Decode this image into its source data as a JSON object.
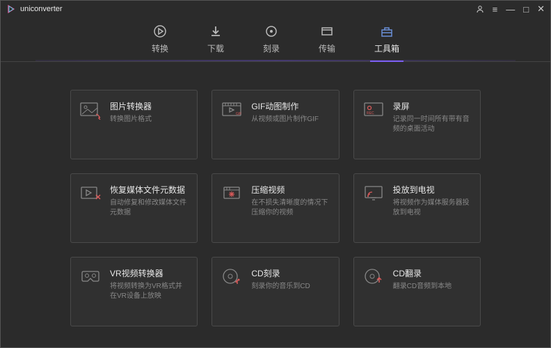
{
  "app": {
    "title": "uniconverter"
  },
  "window_controls": {
    "user": "",
    "menu": "≡",
    "minimize": "—",
    "maximize": "□",
    "close": "✕"
  },
  "tabs": [
    {
      "label": "转换"
    },
    {
      "label": "下载"
    },
    {
      "label": "刻录"
    },
    {
      "label": "传输"
    },
    {
      "label": "工具箱"
    }
  ],
  "tools": [
    {
      "title": "图片转换器",
      "desc": "转换图片格式"
    },
    {
      "title": "GIF动图制作",
      "desc": "从视频或图片制作GIF"
    },
    {
      "title": "录屏",
      "desc": "记录同一时间所有带有音频的桌面活动"
    },
    {
      "title": "恢复媒体文件元数据",
      "desc": "自动修复和修改媒体文件元数据"
    },
    {
      "title": "压缩视频",
      "desc": "在不损失清晰度的情况下压缩你的视频"
    },
    {
      "title": "投放到电视",
      "desc": "将视频作为媒体服务器投放到电视"
    },
    {
      "title": "VR视频转换器",
      "desc": "将视频转换为VR格式并在VR设备上放映"
    },
    {
      "title": "CD刻录",
      "desc": "刻录你的音乐到CD"
    },
    {
      "title": "CD翻录",
      "desc": "翻录CD音频到本地"
    }
  ]
}
